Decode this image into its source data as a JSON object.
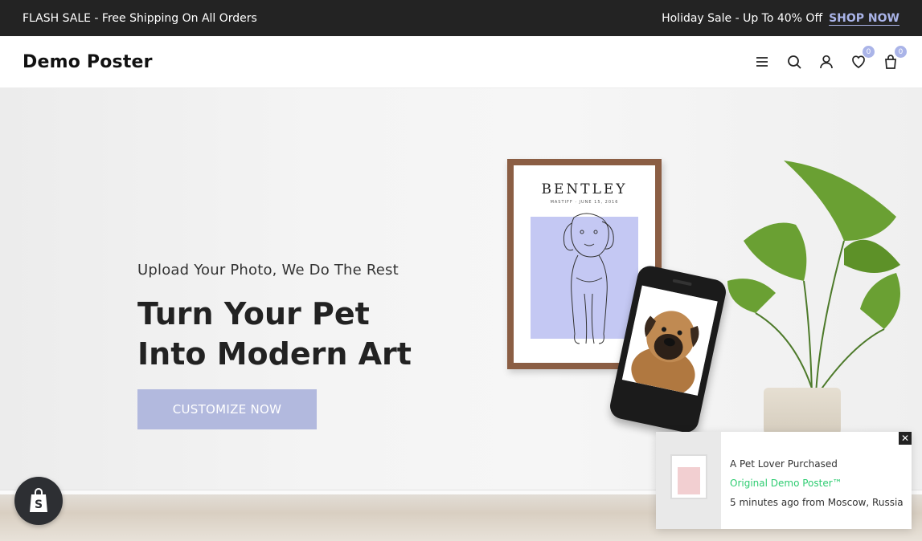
{
  "announcement": {
    "left_text": "FLASH SALE - Free Shipping On All Orders",
    "right_text": "Holiday Sale - Up To 40% Off",
    "shop_now_label": "SHOP NOW"
  },
  "header": {
    "logo": "Demo Poster",
    "icons": [
      "menu-icon",
      "search-icon",
      "account-icon",
      "wishlist-icon",
      "cart-icon"
    ],
    "wishlist_count": "0",
    "cart_count": "0"
  },
  "hero": {
    "subtitle": "Upload Your Photo, We Do The Rest",
    "title_line1": "Turn Your Pet",
    "title_line2": "Into Modern Art",
    "cta_label": "CUSTOMIZE NOW",
    "poster_name": "BENTLEY",
    "poster_subtitle": "MASTIFF · JUNE 15, 2016"
  },
  "notification": {
    "line1": "A Pet Lover Purchased",
    "product": "Original Demo Poster™",
    "line3": "5 minutes ago from Moscow, Russia",
    "close_label": "✕"
  },
  "colors": {
    "accent": "#aab4e8",
    "cta_bg": "#b2b9de",
    "announce_bg": "#232323",
    "product_green": "#2ecc71"
  }
}
